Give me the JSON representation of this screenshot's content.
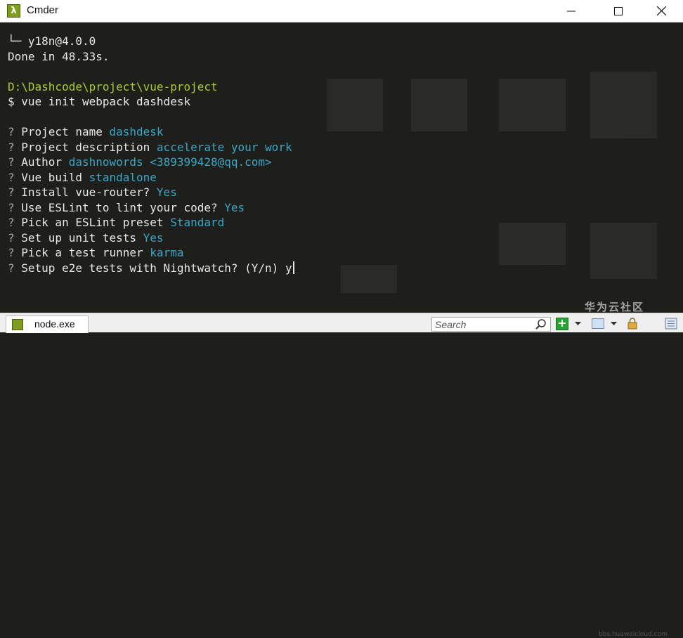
{
  "window": {
    "title": "Cmder",
    "app_icon_glyph": "λ"
  },
  "terminal": {
    "lines": [
      [
        {
          "t": "└─ y18n@4.0.0",
          "c": "white"
        }
      ],
      [
        {
          "t": "Done in 48.33s.",
          "c": "white"
        }
      ],
      [
        {
          "t": "",
          "c": "white"
        }
      ],
      [
        {
          "t": "D:\\Dashcode\\project\\vue-project",
          "c": "green"
        }
      ],
      [
        {
          "t": "$ vue init webpack dashdesk",
          "c": "white"
        }
      ],
      [
        {
          "t": "",
          "c": "white"
        }
      ],
      [
        {
          "t": "? ",
          "c": "q"
        },
        {
          "t": "Project name ",
          "c": "white"
        },
        {
          "t": "dashdesk",
          "c": "cyan"
        }
      ],
      [
        {
          "t": "? ",
          "c": "q"
        },
        {
          "t": "Project description ",
          "c": "white"
        },
        {
          "t": "accelerate your work",
          "c": "cyan"
        }
      ],
      [
        {
          "t": "? ",
          "c": "q"
        },
        {
          "t": "Author ",
          "c": "white"
        },
        {
          "t": "dashnowords <389399428@qq.com>",
          "c": "cyan"
        }
      ],
      [
        {
          "t": "? ",
          "c": "q"
        },
        {
          "t": "Vue build ",
          "c": "white"
        },
        {
          "t": "standalone",
          "c": "cyan"
        }
      ],
      [
        {
          "t": "? ",
          "c": "q"
        },
        {
          "t": "Install vue-router? ",
          "c": "white"
        },
        {
          "t": "Yes",
          "c": "cyan"
        }
      ],
      [
        {
          "t": "? ",
          "c": "q"
        },
        {
          "t": "Use ESLint to lint your code? ",
          "c": "white"
        },
        {
          "t": "Yes",
          "c": "cyan"
        }
      ],
      [
        {
          "t": "? ",
          "c": "q"
        },
        {
          "t": "Pick an ESLint preset ",
          "c": "white"
        },
        {
          "t": "Standard",
          "c": "cyan"
        }
      ],
      [
        {
          "t": "? ",
          "c": "q"
        },
        {
          "t": "Set up unit tests ",
          "c": "white"
        },
        {
          "t": "Yes",
          "c": "cyan"
        }
      ],
      [
        {
          "t": "? ",
          "c": "q"
        },
        {
          "t": "Pick a test runner ",
          "c": "white"
        },
        {
          "t": "karma",
          "c": "cyan"
        }
      ],
      [
        {
          "t": "? ",
          "c": "q"
        },
        {
          "t": "Setup e2e tests with Nightwatch? (Y/n) y",
          "c": "white"
        }
      ]
    ]
  },
  "statusbar": {
    "tab_label": "node.exe",
    "search_placeholder": "Search"
  },
  "watermark": {
    "text": "华为云社区",
    "url": "bbs.huaweicloud.com"
  },
  "colors": {
    "background": "#1e1f1b",
    "green": "#a8cc3a",
    "cyan": "#3aa6c8",
    "accent_green": "#27a134"
  }
}
